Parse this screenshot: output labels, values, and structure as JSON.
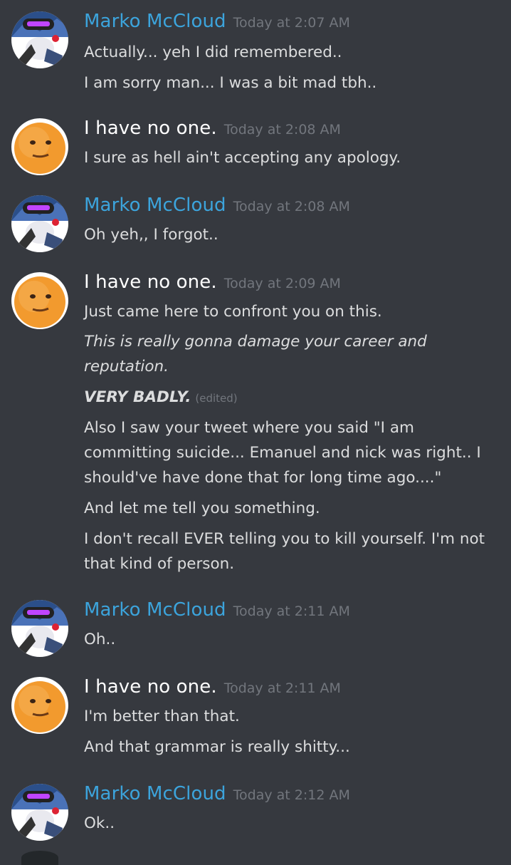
{
  "colors": {
    "background": "#36393f",
    "marko_name": "#3ca4dc",
    "noone_name": "#ffffff",
    "timestamp": "#72767d",
    "message_text": "#dcddde"
  },
  "users": {
    "marko": {
      "name": "Marko McCloud",
      "avatar_icon": "robot-avatar-icon"
    },
    "noone": {
      "name": "I have no one.",
      "avatar_icon": "orange-avatar-icon"
    }
  },
  "messages": [
    {
      "author": "Marko McCloud",
      "time": "Today at 2:07 AM",
      "lines": [
        "Actually... yeh I did remembered..",
        "I am sorry man... I was a bit mad tbh.."
      ]
    },
    {
      "author": "I have no one.",
      "time": "Today at 2:08 AM",
      "lines": [
        "I sure as hell ain't accepting any apology."
      ]
    },
    {
      "author": "Marko McCloud",
      "time": "Today at 2:08 AM",
      "lines": [
        "Oh yeh,, I forgot.."
      ]
    },
    {
      "author": "I have no one.",
      "time": "Today at 2:09 AM",
      "lines": [
        "Just came here to confront you on this.",
        "This is really gonna damage your career and reputation.",
        "VERY BADLY.",
        "(edited)",
        "Also I saw your tweet where you said \"I am committing suicide... Emanuel and nick was right.. I should've have done that for long time ago....\"",
        "And let me tell you something.",
        "I don't recall EVER telling you to kill yourself. I'm not that kind of person."
      ]
    },
    {
      "author": "Marko McCloud",
      "time": "Today at 2:11 AM",
      "lines": [
        "Oh.."
      ]
    },
    {
      "author": "I have no one.",
      "time": "Today at 2:11 AM",
      "lines": [
        "I'm better than that.",
        "And that grammar is really shitty..."
      ]
    },
    {
      "author": "Marko McCloud",
      "time": "Today at 2:12 AM",
      "lines": [
        "Ok.."
      ]
    }
  ]
}
